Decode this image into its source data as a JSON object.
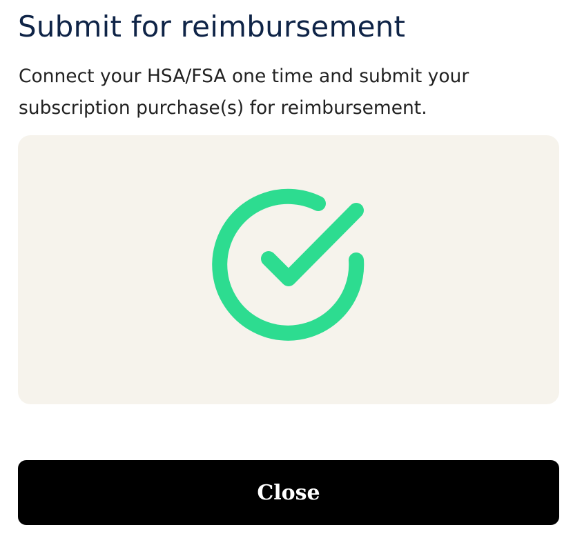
{
  "modal": {
    "title": "Submit for reimbursement",
    "description": "Connect your HSA/FSA one time and submit your subscription purchase(s) for reimbursement.",
    "illustration": {
      "icon": "check-circle-icon",
      "icon_color": "#2ddc90",
      "panel_color": "#f6f3ec"
    },
    "close_button": {
      "label": "Close",
      "background": "#000000",
      "text_color": "#ffffff"
    }
  }
}
